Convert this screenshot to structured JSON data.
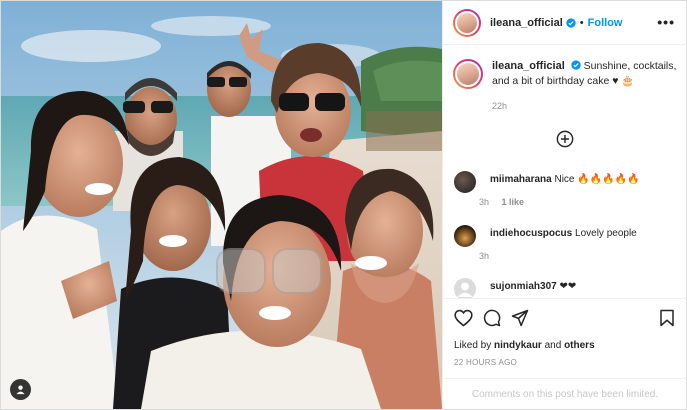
{
  "post": {
    "username": "ileana_official",
    "follow_label": "Follow",
    "separator": "•",
    "more_label": "•••",
    "caption": {
      "username": "ileana_official",
      "text": "Sunshine, cocktails, and a bit of birthday cake ♥ 🎂",
      "time": "22h"
    },
    "comments": [
      {
        "username": "miimaharana",
        "text": "Nice 🔥🔥🔥🔥🔥",
        "time": "3h",
        "likes": "1 like"
      },
      {
        "username": "indiehocuspocus",
        "text": "Lovely people",
        "time": "3h"
      },
      {
        "username": "sujonmiah307",
        "text": "❤❤"
      }
    ],
    "liked_by": {
      "prefix": "Liked by ",
      "user": "nindykaur",
      "middle": " and ",
      "suffix": "others"
    },
    "timestamp": "22 HOURS AGO",
    "comments_limited": "Comments on this post have been limited."
  },
  "colors": {
    "accent": "#0095f6",
    "muted": "#8e8e8e",
    "text": "#262626"
  },
  "icons": [
    "verified-badge-icon",
    "more-options-icon",
    "add-comments-icon",
    "heart-icon",
    "comment-icon",
    "share-icon",
    "bookmark-icon",
    "tagged-user-icon"
  ]
}
